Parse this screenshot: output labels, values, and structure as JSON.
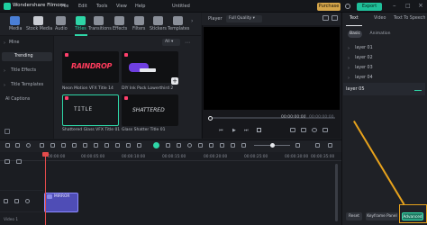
{
  "app": {
    "name": "Wondershare Filmora",
    "menu": [
      "File",
      "Edit",
      "Tools",
      "View",
      "Help"
    ],
    "project_title": "Untitled",
    "purchase_label": "Purchase",
    "export_label": "Export"
  },
  "library": {
    "tabs": [
      {
        "label": "Media"
      },
      {
        "label": "Stock Media"
      },
      {
        "label": "Audio"
      },
      {
        "label": "Titles"
      },
      {
        "label": "Transitions"
      },
      {
        "label": "Effects"
      },
      {
        "label": "Filters"
      },
      {
        "label": "Stickers"
      },
      {
        "label": "Templates"
      }
    ],
    "active_tab": "Titles",
    "sidebar": {
      "items": [
        "Mine",
        "Trending",
        "Title Effects",
        "Title Templates",
        "AI Captions"
      ],
      "selected": "Trending"
    },
    "filter_label": "All",
    "thumbnails": [
      {
        "caption": "Neon Motion VFX Title 14",
        "art": "RAINDROP"
      },
      {
        "caption": "DIY Ink Pack Lowerthird 2",
        "art": ""
      },
      {
        "caption": "Shattered Glass VFX Title 01",
        "art": "TITLE"
      },
      {
        "caption": "Glass Shatter Title 01",
        "art": "SHATTERED"
      }
    ]
  },
  "player": {
    "label": "Player",
    "quality": "Full Quality",
    "time_current": "00:00:00:00",
    "time_total": "00:00:00:00"
  },
  "properties": {
    "tabs": [
      "Text",
      "Video",
      "Text To Speech"
    ],
    "active_tab": "Text",
    "sub_tabs": [
      "Basic",
      "Animation"
    ],
    "active_sub_tab": "Basic",
    "layers": [
      "layer 01",
      "layer 02",
      "layer 03",
      "layer 04"
    ],
    "selected_layer": "layer 05",
    "reset_label": "Reset",
    "keyframe_label": "Keyframe Panel",
    "advanced_label": "Advanced"
  },
  "timeline": {
    "ruler_labels": [
      "00:00:00",
      "00:00:05:00",
      "00:00:10:00",
      "00:00:15:00",
      "00:00:20:00",
      "00:00:25:00",
      "00:00:30:00",
      "00:00:35:00"
    ],
    "clip_label": "MIRROR",
    "track_label": "Video 1"
  },
  "colors": {
    "accent": "#2ed6a7",
    "purchase": "#d4a54a",
    "export": "#1fbf9a",
    "highlight": "#e7a21c",
    "playhead": "#e34b4b",
    "clip": "#4f4db6"
  }
}
